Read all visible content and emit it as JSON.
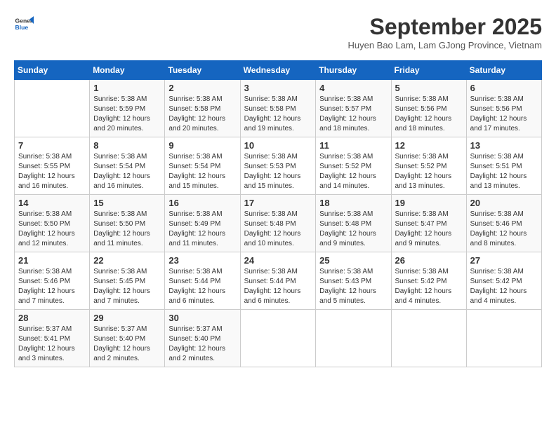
{
  "header": {
    "logo_line1": "General",
    "logo_line2": "Blue",
    "month_title": "September 2025",
    "subtitle": "Huyen Bao Lam, Lam GJong Province, Vietnam"
  },
  "columns": [
    "Sunday",
    "Monday",
    "Tuesday",
    "Wednesday",
    "Thursday",
    "Friday",
    "Saturday"
  ],
  "weeks": [
    [
      {
        "day": "",
        "info": ""
      },
      {
        "day": "1",
        "info": "Sunrise: 5:38 AM\nSunset: 5:59 PM\nDaylight: 12 hours\nand 20 minutes."
      },
      {
        "day": "2",
        "info": "Sunrise: 5:38 AM\nSunset: 5:58 PM\nDaylight: 12 hours\nand 20 minutes."
      },
      {
        "day": "3",
        "info": "Sunrise: 5:38 AM\nSunset: 5:58 PM\nDaylight: 12 hours\nand 19 minutes."
      },
      {
        "day": "4",
        "info": "Sunrise: 5:38 AM\nSunset: 5:57 PM\nDaylight: 12 hours\nand 18 minutes."
      },
      {
        "day": "5",
        "info": "Sunrise: 5:38 AM\nSunset: 5:56 PM\nDaylight: 12 hours\nand 18 minutes."
      },
      {
        "day": "6",
        "info": "Sunrise: 5:38 AM\nSunset: 5:56 PM\nDaylight: 12 hours\nand 17 minutes."
      }
    ],
    [
      {
        "day": "7",
        "info": "Sunrise: 5:38 AM\nSunset: 5:55 PM\nDaylight: 12 hours\nand 16 minutes."
      },
      {
        "day": "8",
        "info": "Sunrise: 5:38 AM\nSunset: 5:54 PM\nDaylight: 12 hours\nand 16 minutes."
      },
      {
        "day": "9",
        "info": "Sunrise: 5:38 AM\nSunset: 5:54 PM\nDaylight: 12 hours\nand 15 minutes."
      },
      {
        "day": "10",
        "info": "Sunrise: 5:38 AM\nSunset: 5:53 PM\nDaylight: 12 hours\nand 15 minutes."
      },
      {
        "day": "11",
        "info": "Sunrise: 5:38 AM\nSunset: 5:52 PM\nDaylight: 12 hours\nand 14 minutes."
      },
      {
        "day": "12",
        "info": "Sunrise: 5:38 AM\nSunset: 5:52 PM\nDaylight: 12 hours\nand 13 minutes."
      },
      {
        "day": "13",
        "info": "Sunrise: 5:38 AM\nSunset: 5:51 PM\nDaylight: 12 hours\nand 13 minutes."
      }
    ],
    [
      {
        "day": "14",
        "info": "Sunrise: 5:38 AM\nSunset: 5:50 PM\nDaylight: 12 hours\nand 12 minutes."
      },
      {
        "day": "15",
        "info": "Sunrise: 5:38 AM\nSunset: 5:50 PM\nDaylight: 12 hours\nand 11 minutes."
      },
      {
        "day": "16",
        "info": "Sunrise: 5:38 AM\nSunset: 5:49 PM\nDaylight: 12 hours\nand 11 minutes."
      },
      {
        "day": "17",
        "info": "Sunrise: 5:38 AM\nSunset: 5:48 PM\nDaylight: 12 hours\nand 10 minutes."
      },
      {
        "day": "18",
        "info": "Sunrise: 5:38 AM\nSunset: 5:48 PM\nDaylight: 12 hours\nand 9 minutes."
      },
      {
        "day": "19",
        "info": "Sunrise: 5:38 AM\nSunset: 5:47 PM\nDaylight: 12 hours\nand 9 minutes."
      },
      {
        "day": "20",
        "info": "Sunrise: 5:38 AM\nSunset: 5:46 PM\nDaylight: 12 hours\nand 8 minutes."
      }
    ],
    [
      {
        "day": "21",
        "info": "Sunrise: 5:38 AM\nSunset: 5:46 PM\nDaylight: 12 hours\nand 7 minutes."
      },
      {
        "day": "22",
        "info": "Sunrise: 5:38 AM\nSunset: 5:45 PM\nDaylight: 12 hours\nand 7 minutes."
      },
      {
        "day": "23",
        "info": "Sunrise: 5:38 AM\nSunset: 5:44 PM\nDaylight: 12 hours\nand 6 minutes."
      },
      {
        "day": "24",
        "info": "Sunrise: 5:38 AM\nSunset: 5:44 PM\nDaylight: 12 hours\nand 6 minutes."
      },
      {
        "day": "25",
        "info": "Sunrise: 5:38 AM\nSunset: 5:43 PM\nDaylight: 12 hours\nand 5 minutes."
      },
      {
        "day": "26",
        "info": "Sunrise: 5:38 AM\nSunset: 5:42 PM\nDaylight: 12 hours\nand 4 minutes."
      },
      {
        "day": "27",
        "info": "Sunrise: 5:38 AM\nSunset: 5:42 PM\nDaylight: 12 hours\nand 4 minutes."
      }
    ],
    [
      {
        "day": "28",
        "info": "Sunrise: 5:37 AM\nSunset: 5:41 PM\nDaylight: 12 hours\nand 3 minutes."
      },
      {
        "day": "29",
        "info": "Sunrise: 5:37 AM\nSunset: 5:40 PM\nDaylight: 12 hours\nand 2 minutes."
      },
      {
        "day": "30",
        "info": "Sunrise: 5:37 AM\nSunset: 5:40 PM\nDaylight: 12 hours\nand 2 minutes."
      },
      {
        "day": "",
        "info": ""
      },
      {
        "day": "",
        "info": ""
      },
      {
        "day": "",
        "info": ""
      },
      {
        "day": "",
        "info": ""
      }
    ]
  ]
}
